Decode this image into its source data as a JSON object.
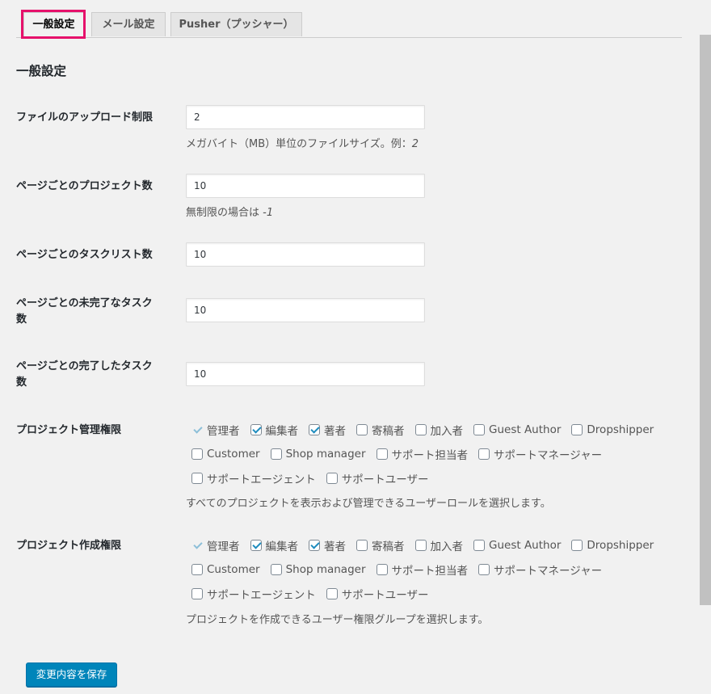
{
  "tabs": [
    {
      "label": "一般設定"
    },
    {
      "label": "メール設定"
    },
    {
      "label": "Pusher（プッシャー）"
    }
  ],
  "section_title": "一般設定",
  "fields": {
    "upload_limit": {
      "label": "ファイルのアップロード制限",
      "value": "2",
      "desc": "メガバイト（MB）単位のファイルサイズ。例：",
      "desc_example": "2"
    },
    "projects_per_page": {
      "label": "ページごとのプロジェクト数",
      "value": "10",
      "desc": "無制限の場合は ",
      "desc_example": "-1"
    },
    "tasklists_per_page": {
      "label": "ページごとのタスクリスト数",
      "value": "10"
    },
    "incomplete_tasks_per_page": {
      "label_line1": "ページごとの未完了なタスク",
      "label_line2": "数",
      "value": "10"
    },
    "completed_tasks_per_page": {
      "label_line1": "ページごとの完了したタスク",
      "label_line2": "数",
      "value": "10"
    }
  },
  "project_manage": {
    "label": "プロジェクト管理権限",
    "roles": [
      "管理者",
      "編集者",
      "著者",
      "寄稿者",
      "加入者",
      "Guest Author",
      "Dropshipper",
      "Customer",
      "Shop manager",
      "サポート担当者",
      "サポートマネージャー",
      "サポートエージェント",
      "サポートユーザー"
    ],
    "desc": "すべてのプロジェクトを表示および管理できるユーザーロールを選択します。"
  },
  "project_create": {
    "label": "プロジェクト作成権限",
    "roles": [
      "管理者",
      "編集者",
      "著者",
      "寄稿者",
      "加入者",
      "Guest Author",
      "Dropshipper",
      "Customer",
      "Shop manager",
      "サポート担当者",
      "サポートマネージャー",
      "サポートエージェント",
      "サポートユーザー"
    ],
    "desc": "プロジェクトを作成できるユーザー権限グループを選択します。"
  },
  "save_label": "変更内容を保存",
  "colors": {
    "accent": "#0085ba",
    "highlight": "#e6116b",
    "checkmark": "#1e8cbe"
  }
}
